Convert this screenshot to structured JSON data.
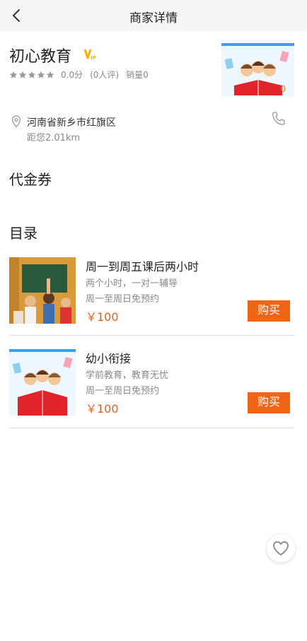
{
  "header": {
    "title": "商家详情",
    "back_icon": "chevron-left-icon"
  },
  "shop": {
    "name": "初心教育",
    "vip_badge": "VIP",
    "rating_text": "0.0分",
    "review_text": "(0人评)",
    "sales_text": "销量0",
    "cover_count": "0",
    "address": "河南省新乡市红旗区",
    "distance": "距您2.01km",
    "star_count": 5
  },
  "sections": {
    "vouchers": "代金券",
    "catalog": "目录"
  },
  "products": [
    {
      "name": "周一到周五课后两小时",
      "desc": "两个小时，一对一辅导",
      "time": "周一至周日免预约",
      "price": "￥100",
      "buy_label": "购买"
    },
    {
      "name": "幼小衔接",
      "desc": "学前教育，教育无忧",
      "time": "周一至周日免预约",
      "price": "￥100",
      "buy_label": "购买"
    }
  ],
  "colors": {
    "accent": "#f06414",
    "price": "#e7601a",
    "vip": "#f2b400",
    "cover_border": "#3aa0e8",
    "nav_bg": "#f5f5f5"
  },
  "favorite": {
    "icon": "heart-outline-icon"
  }
}
